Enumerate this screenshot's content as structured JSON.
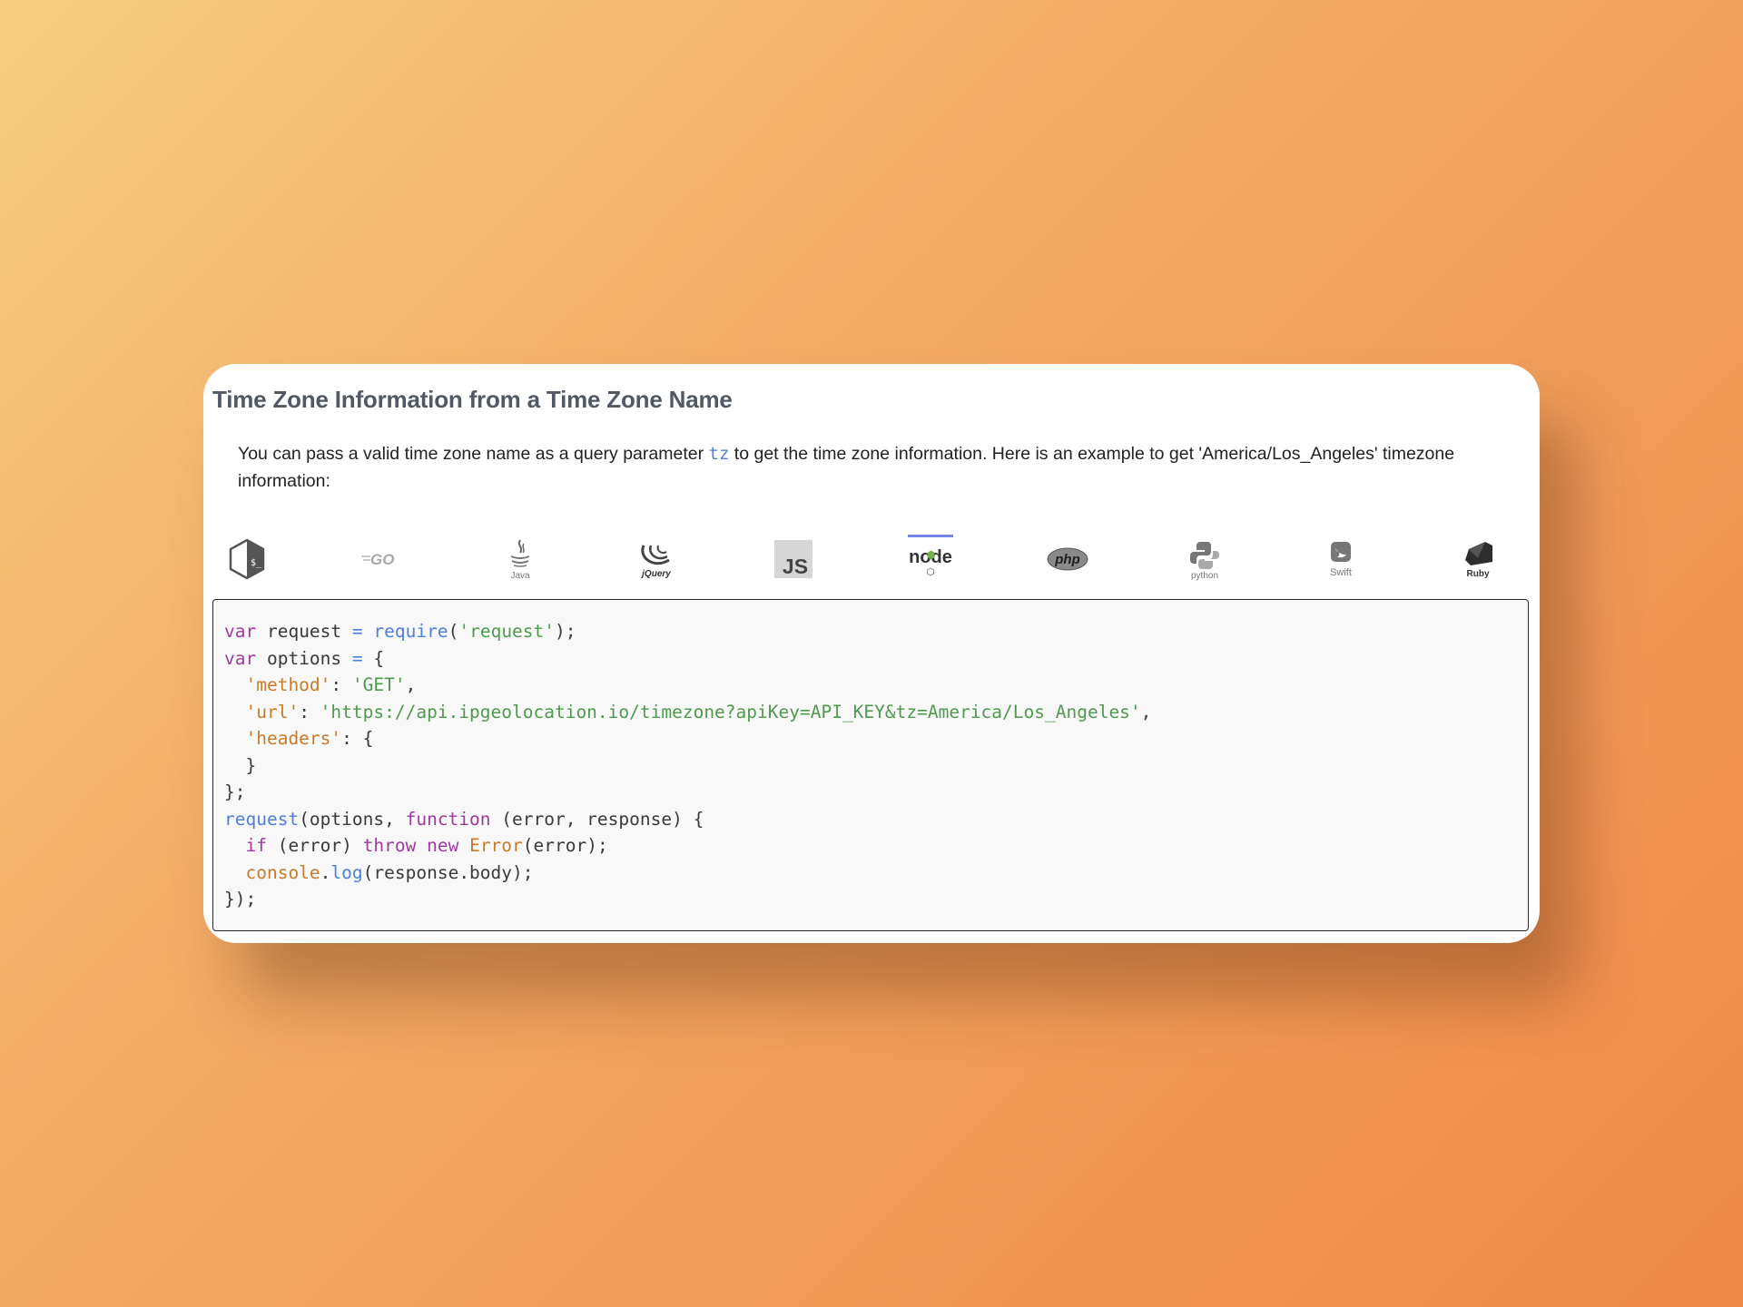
{
  "title": "Time Zone Information from a Time Zone Name",
  "description": {
    "before": "You can pass a valid time zone name as a query parameter ",
    "param": "tz",
    "after": " to get the time zone information. Here is an example to get 'America/Los_Angeles' timezone information:"
  },
  "tabs": [
    {
      "id": "shell",
      "label": "$_",
      "icon": "shell-icon"
    },
    {
      "id": "go",
      "label": "GO",
      "icon": "go-icon"
    },
    {
      "id": "java",
      "label": "Java",
      "icon": "java-icon"
    },
    {
      "id": "jquery",
      "label": "jQuery",
      "icon": "jquery-icon"
    },
    {
      "id": "js",
      "label": "JS",
      "icon": "js-icon"
    },
    {
      "id": "node",
      "label": "node",
      "icon": "nodejs-icon",
      "active": true
    },
    {
      "id": "php",
      "label": "php",
      "icon": "php-icon"
    },
    {
      "id": "python",
      "label": "python",
      "icon": "python-icon"
    },
    {
      "id": "swift",
      "label": "Swift",
      "icon": "swift-icon"
    },
    {
      "id": "ruby",
      "label": "Ruby",
      "icon": "ruby-icon"
    }
  ],
  "code": {
    "language": "node",
    "url": "https://api.ipgeolocation.io/timezone?apiKey=API_KEY&tz=America/Los_Angeles",
    "module": "request",
    "method": "GET"
  },
  "colors": {
    "keyword": "#a03aa0",
    "function": "#4f7fd8",
    "string": "#4e9a4e",
    "property": "#c97a2b",
    "active_tab": "#7385e6"
  }
}
